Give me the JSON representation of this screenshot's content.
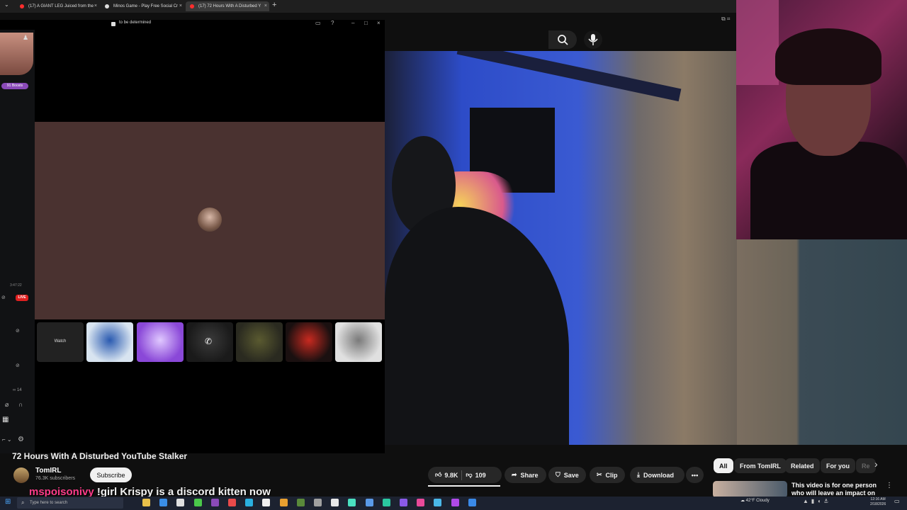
{
  "browser": {
    "tabs": [
      {
        "title": "(17) A GIANT LEG Juiced from the",
        "favicon_color": "#ff2d2d"
      },
      {
        "title": "Minos Game - Play Free Social Cr",
        "favicon_color": "#dddddd"
      },
      {
        "title": "(17) 72 Hours With A Disturbed Y",
        "favicon_color": "#ff2d2d"
      }
    ],
    "new_tab": "+",
    "close_glyph": "×"
  },
  "discord": {
    "window_title": "to be determined",
    "boosts": "91 Boosts",
    "live_label": "LIVE",
    "timer": "3:47:22",
    "watch_label": "Watch",
    "tiles": [
      {
        "colors": [
          "#d8e4f0",
          "#2a5ab0"
        ]
      },
      {
        "colors": [
          "#8a48d8",
          "#e0c8ff"
        ]
      },
      {
        "colors": [
          "#1a1a1a",
          "#3a3a3a"
        ]
      },
      {
        "colors": [
          "#2a2a20",
          "#5a5a30"
        ]
      },
      {
        "colors": [
          "#1a1010",
          "#c82a20"
        ]
      },
      {
        "colors": [
          "#e0e0e0",
          "#7a7a7a"
        ]
      }
    ],
    "accent": "#8a4ab8"
  },
  "youtube": {
    "video_title": "72 Hours With A Disturbed YouTube Stalker",
    "channel": {
      "name": "TomIRL",
      "subscribers": "76.3K subscribers"
    },
    "subscribe_label": "Subscribe",
    "actions": {
      "likes": "9.8K",
      "dislikes": "109",
      "share": "Share",
      "save": "Save",
      "clip": "Clip",
      "download": "Download",
      "more": "•••"
    },
    "chips": [
      "All",
      "From TomIRL",
      "Related",
      "For you",
      "Re"
    ],
    "recommendation": {
      "title": "This video is for one person who will leave an impact on th"
    },
    "icons": {
      "search": "search-icon",
      "mic": "mic-icon"
    }
  },
  "stream_overlay": {
    "user": "mspoisonivy",
    "message": " !girl Krispy is a discord kitten now"
  },
  "taskbar": {
    "search_placeholder": "Type here to search",
    "weather": "42°F Cloudy",
    "time": "12:16 AM",
    "date": "2/18/2026",
    "app_colors": [
      "#e8c04a",
      "#3a8ee8",
      "#e0e0e0",
      "#4ac84a",
      "#8a4ab8",
      "#e84a4a",
      "#2ab0e0",
      "#f0f0f0",
      "#e8a030",
      "#5a8a3a",
      "#a0a0a0",
      "#e8e8e8",
      "#4ae0c0",
      "#5a9ae8",
      "#2ac8a0",
      "#8a5ae8",
      "#e84a9a",
      "#4ab8e8",
      "#b04ae8",
      "#3a8ae8"
    ]
  }
}
